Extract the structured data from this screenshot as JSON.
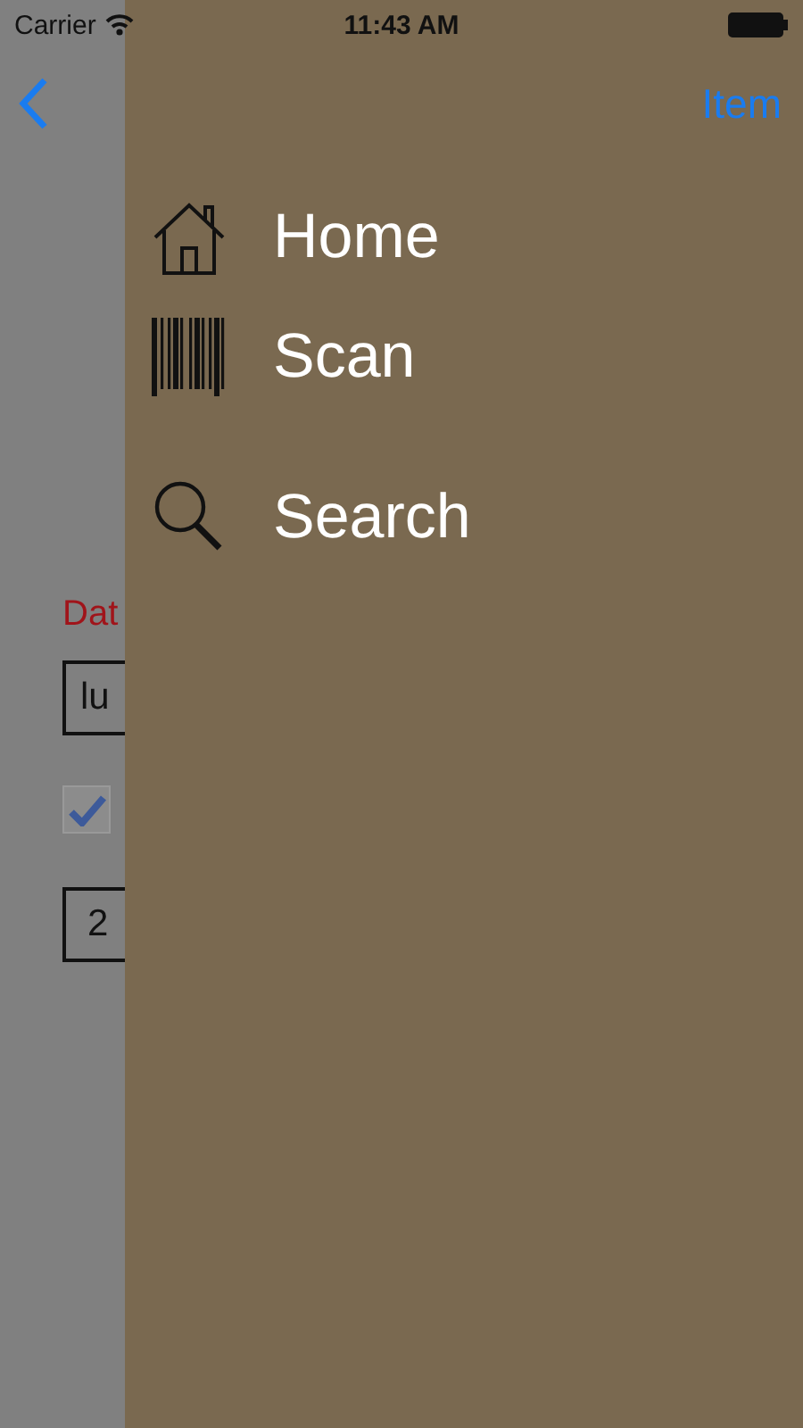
{
  "status_bar": {
    "carrier": "Carrier",
    "time": "11:43 AM"
  },
  "nav_bar": {
    "right_button": "Item"
  },
  "form": {
    "label": "Dat",
    "field_1": "lu",
    "checkbox": {
      "checked": true
    },
    "field_2": "2"
  },
  "menu": [
    {
      "kind": "home",
      "label": "Home"
    },
    {
      "kind": "scan",
      "label": "Scan"
    },
    {
      "kind": "search",
      "label": "Search"
    }
  ]
}
